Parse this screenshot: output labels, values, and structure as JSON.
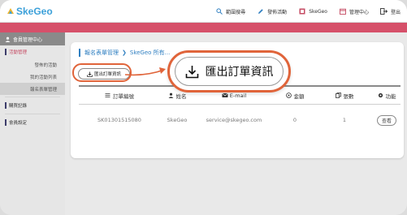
{
  "app": {
    "logo_text": "SkeGeo"
  },
  "topnav": [
    {
      "label": "範圍搜尋",
      "icon": "search-icon"
    },
    {
      "label": "發佈活動",
      "icon": "edit-icon"
    },
    {
      "label": "SkeGeo",
      "icon": "skegeo-icon"
    },
    {
      "label": "管理中心",
      "icon": "calendar-icon"
    },
    {
      "label": "登出",
      "icon": "logout-icon"
    }
  ],
  "sidebar": {
    "header": "會員管理中心",
    "sections": [
      {
        "label": "活動管理",
        "active": true
      },
      {
        "label": "購買記錄",
        "active": false
      },
      {
        "label": "會員設定",
        "active": false
      }
    ],
    "sub_items": [
      {
        "label": "發佈的活動"
      },
      {
        "label": "我的活動列表"
      },
      {
        "label": "報名表單管理"
      }
    ]
  },
  "breadcrumb": {
    "first": "報名表單管理",
    "second": "SkeGeo 所有..."
  },
  "export_button": {
    "label": "匯出訂單資訊"
  },
  "callout": {
    "label": "匯出訂單資訊"
  },
  "table": {
    "headers": [
      {
        "label": "訂單編號",
        "icon": "list-icon"
      },
      {
        "label": "姓名",
        "icon": "user-icon"
      },
      {
        "label": "E-mail",
        "icon": "mail-icon"
      },
      {
        "label": "金額",
        "icon": "coin-icon"
      },
      {
        "label": "張數",
        "icon": "copy-icon"
      },
      {
        "label": "功能",
        "icon": "gear-icon"
      }
    ],
    "rows": [
      {
        "order_id": "SK01301515080",
        "name": "SkeGeo",
        "email": "service@skegeo.com",
        "amount": "0",
        "count": "1",
        "action": "查看"
      }
    ]
  },
  "colors": {
    "accent": "#d6506a",
    "link": "#2f7fc1",
    "highlight": "#e0643a"
  }
}
